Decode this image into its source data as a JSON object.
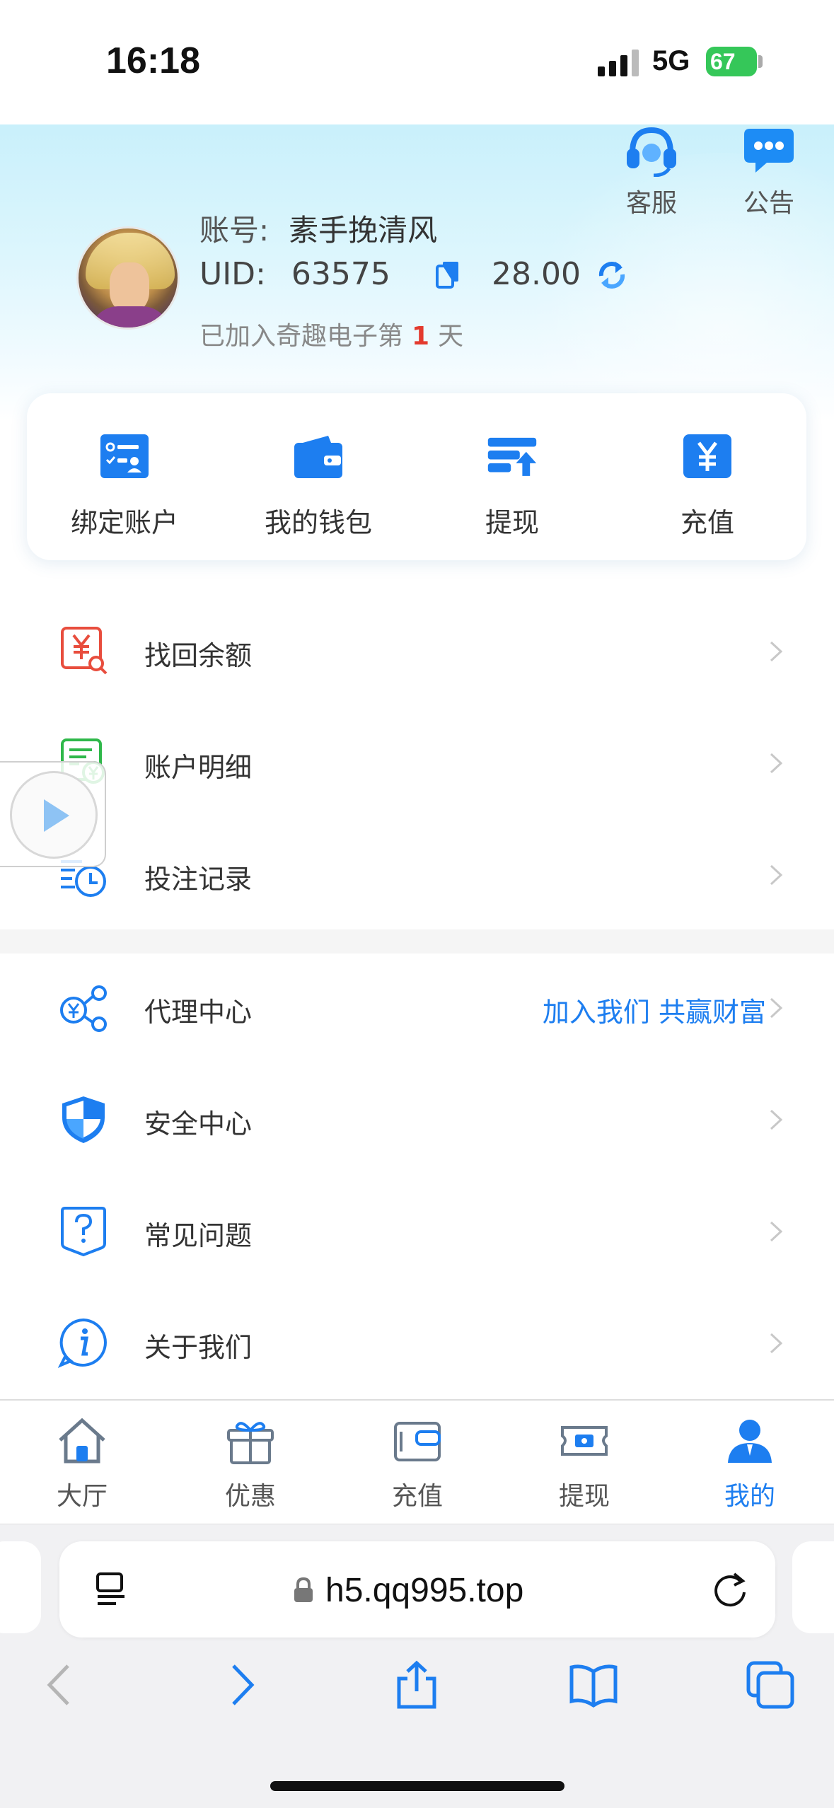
{
  "status_bar": {
    "time": "16:18",
    "network": "5G",
    "battery": "67"
  },
  "header": {
    "customer_service_label": "客服",
    "announcement_label": "公告",
    "account_label": "账号:",
    "account_value": "素手挽清风",
    "uid_label": "UID:",
    "uid_value": "63575",
    "balance": "28.00",
    "joined_prefix": "已加入奇趣电子第",
    "joined_days": "1",
    "joined_suffix": "天"
  },
  "quick_actions": [
    {
      "label": "绑定账户",
      "icon": "bind-account-icon"
    },
    {
      "label": "我的钱包",
      "icon": "wallet-icon"
    },
    {
      "label": "提现",
      "icon": "withdraw-icon"
    },
    {
      "label": "充值",
      "icon": "recharge-icon"
    }
  ],
  "menu": [
    {
      "label": "找回余额",
      "icon": "recover-balance-icon"
    },
    {
      "label": "账户明细",
      "icon": "account-details-icon"
    },
    {
      "label": "投注记录",
      "icon": "bet-records-icon"
    },
    {
      "label": "代理中心",
      "icon": "agent-center-icon",
      "extra": "加入我们 共赢财富"
    },
    {
      "label": "安全中心",
      "icon": "security-center-icon"
    },
    {
      "label": "常见问题",
      "icon": "faq-icon"
    },
    {
      "label": "关于我们",
      "icon": "about-us-icon"
    }
  ],
  "tabs": [
    {
      "label": "大厅",
      "icon": "home-icon",
      "active": false
    },
    {
      "label": "优惠",
      "icon": "gift-icon",
      "active": false
    },
    {
      "label": "充值",
      "icon": "wallet-card-icon",
      "active": false
    },
    {
      "label": "提现",
      "icon": "cash-icon",
      "active": false
    },
    {
      "label": "我的",
      "icon": "user-icon",
      "active": true
    }
  ],
  "browser": {
    "url": "h5.qq995.top"
  },
  "colors": {
    "accent": "#1d7ef0",
    "highlight": "#e33a2e",
    "battery": "#35c759"
  }
}
